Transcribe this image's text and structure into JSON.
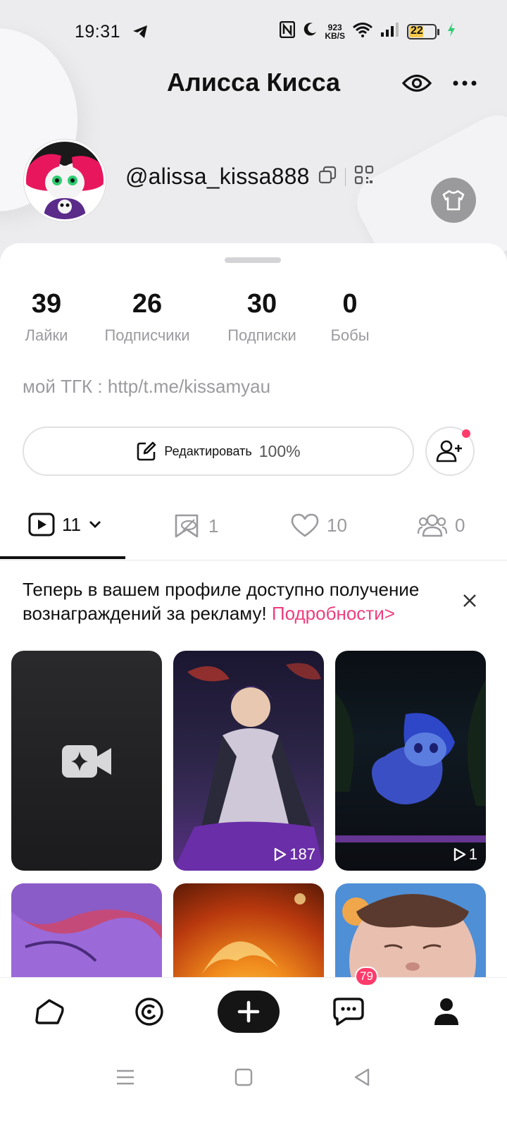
{
  "status_bar": {
    "time": "19:31",
    "net_speed_value": "923",
    "net_speed_unit": "KB/S",
    "battery": "22"
  },
  "profile": {
    "title": "Алисса Кисса",
    "handle": "@alissa_kissa888",
    "bio": "мой ТГК :  http/t.me/kissamyau"
  },
  "stats": [
    {
      "value": "39",
      "label": "Лайки"
    },
    {
      "value": "26",
      "label": "Подписчики"
    },
    {
      "value": "30",
      "label": "Подписки"
    },
    {
      "value": "0",
      "label": "Бобы"
    }
  ],
  "edit_button": {
    "label": "Редактировать",
    "progress": "100%"
  },
  "tabs": [
    {
      "icon": "video-play-icon",
      "count": "11"
    },
    {
      "icon": "bookmark-icon",
      "count": "1"
    },
    {
      "icon": "heart-icon",
      "count": "10"
    },
    {
      "icon": "group-icon",
      "count": "0"
    }
  ],
  "notice": {
    "text": "Теперь в вашем профиле доступно получение вознаграждений за рекламу! ",
    "link": "Подробности>"
  },
  "videos": [
    {
      "type": "create",
      "icon": "video-camera-sparkle-icon"
    },
    {
      "type": "video",
      "views": "187"
    },
    {
      "type": "video",
      "views": "1"
    },
    {
      "type": "video",
      "views": ""
    },
    {
      "type": "video",
      "views": ""
    },
    {
      "type": "video",
      "views": ""
    }
  ],
  "bottom_nav": {
    "items": [
      "home-icon",
      "discover-icon",
      "plus-icon",
      "messages-icon",
      "profile-icon"
    ],
    "messages_badge": "79"
  },
  "colors": {
    "accent": "#ee3e7e",
    "badge": "#ff3b6b",
    "dark": "#151515"
  }
}
